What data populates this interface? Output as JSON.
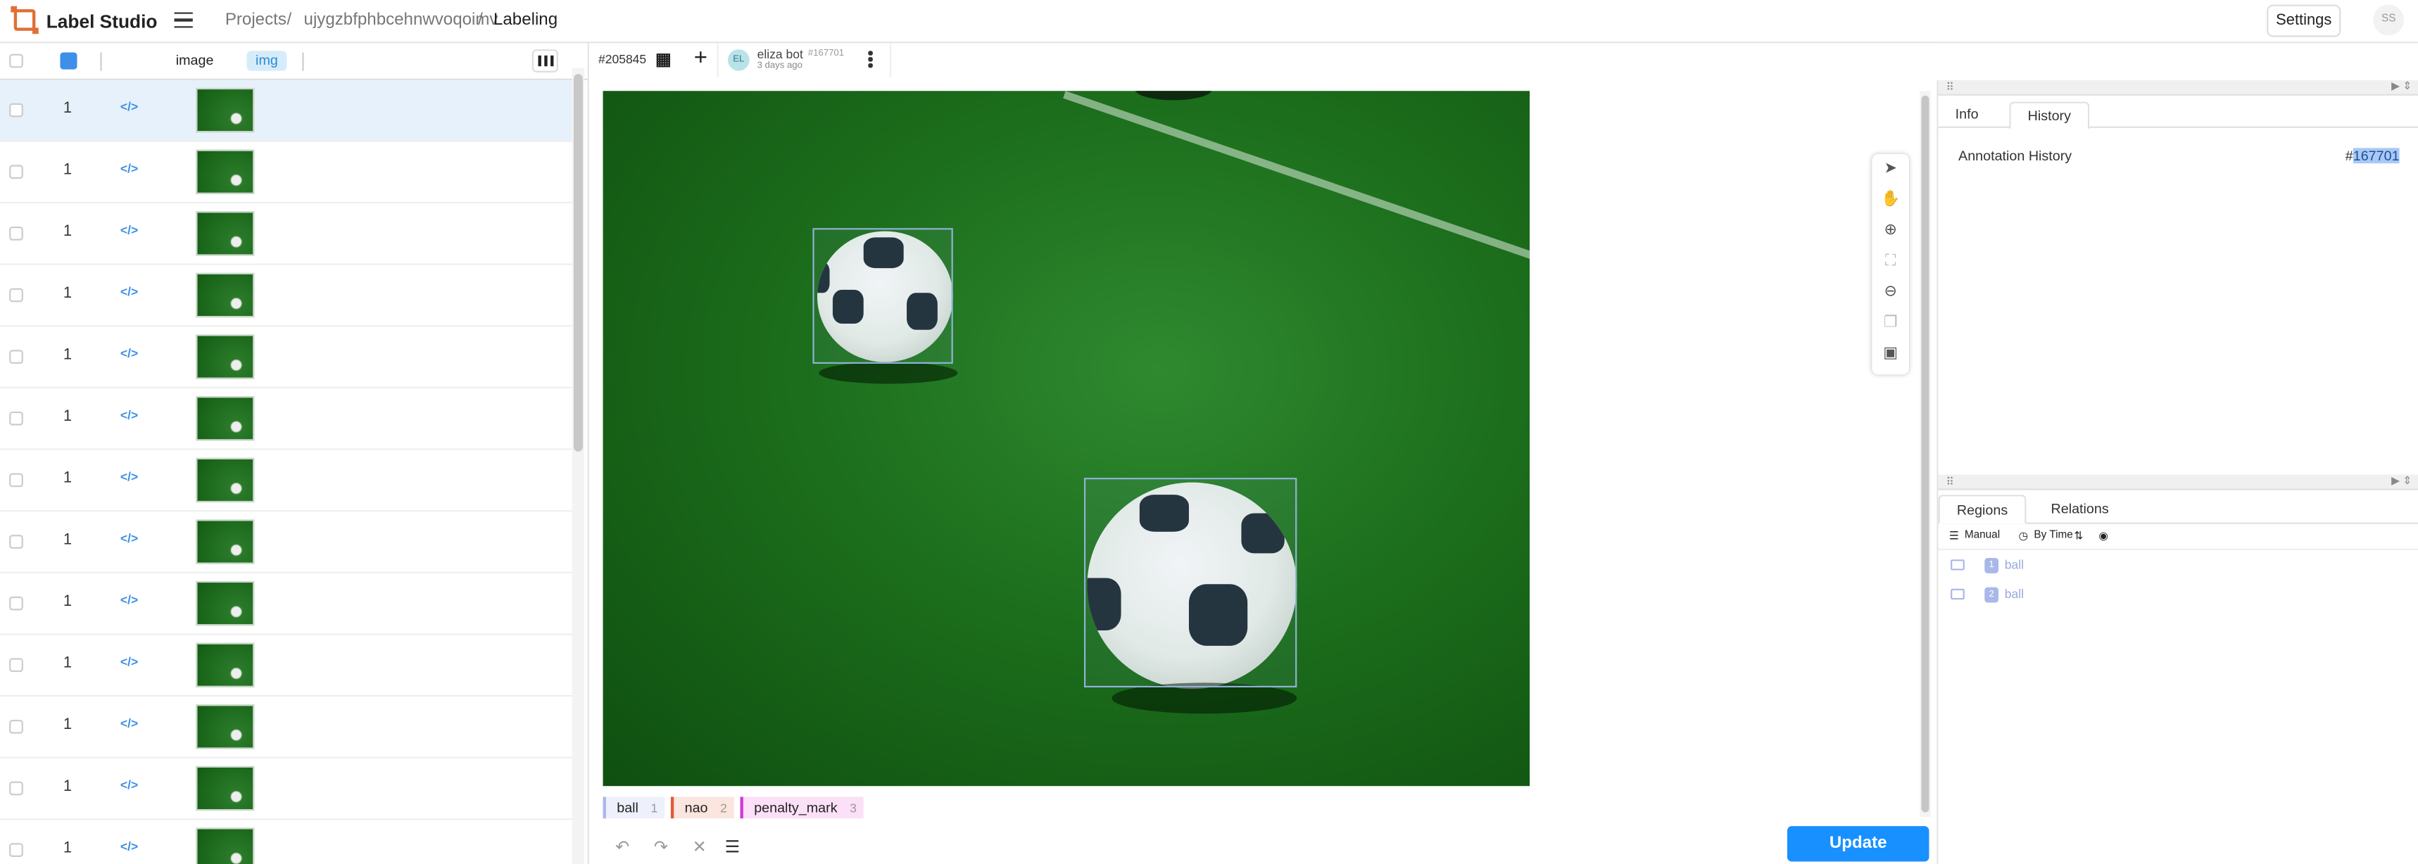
{
  "app": {
    "brand": "Label Studio",
    "settings_label": "Settings",
    "user_initials": "SS"
  },
  "breadcrumbs": [
    "Projects",
    "ujygzbfphbcehnwvoqoimv",
    "Labeling"
  ],
  "list": {
    "column_image": "image",
    "column_tag": "img",
    "rows": [
      {
        "count": "1",
        "selected": true
      },
      {
        "count": "1"
      },
      {
        "count": "1"
      },
      {
        "count": "1"
      },
      {
        "count": "1"
      },
      {
        "count": "1"
      },
      {
        "count": "1"
      },
      {
        "count": "1"
      },
      {
        "count": "1"
      },
      {
        "count": "1"
      },
      {
        "count": "1"
      },
      {
        "count": "1"
      },
      {
        "count": "1"
      }
    ]
  },
  "task": {
    "id": "#205845",
    "user_initials": "EL",
    "user_name": "eliza bot",
    "annotation_id": "#167701",
    "time": "3 days ago"
  },
  "labels": [
    {
      "name": "ball",
      "hotkey": "1",
      "color": "#a9b8e8",
      "bg": "#eef1fb"
    },
    {
      "name": "nao",
      "hotkey": "2",
      "color": "#e05a3a",
      "bg": "#fbe5df"
    },
    {
      "name": "penalty_mark",
      "hotkey": "3",
      "color": "#d23ad2",
      "bg": "#fbe0f7"
    }
  ],
  "actions": {
    "update_label": "Update"
  },
  "tools": [
    "pointer-icon",
    "hand-icon",
    "zoom-in-icon",
    "fit-icon",
    "zoom-out-icon",
    "layers-icon",
    "camera-icon"
  ],
  "right": {
    "tabs": [
      "Info",
      "History"
    ],
    "active_tab": "History",
    "history_title": "Annotation History",
    "history_id_prefix": "#",
    "history_id": "167701",
    "bottom_tabs": [
      "Regions",
      "Relations"
    ],
    "filters": {
      "manual": "Manual",
      "by_time": "By Time"
    },
    "regions": [
      {
        "num": "1",
        "label": "ball"
      },
      {
        "num": "2",
        "label": "ball"
      }
    ]
  }
}
